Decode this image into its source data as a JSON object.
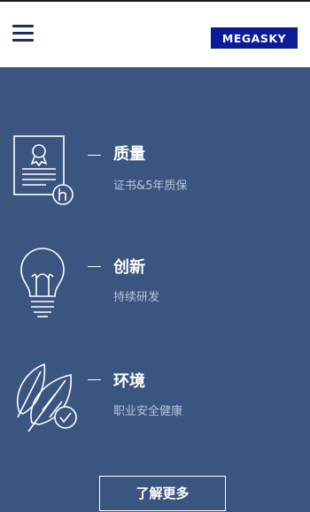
{
  "header": {
    "logo_text": "MEGASKY",
    "menu_icon": "hamburger-menu-icon",
    "logo_color": "#0b1c98"
  },
  "colors": {
    "background": "#3a5580",
    "header_bg": "#ffffff",
    "subtitle": "#b8c4d8"
  },
  "features": [
    {
      "title": "质量",
      "subtitle": "证书&5年质保",
      "icon": "certificate-icon"
    },
    {
      "title": "创新",
      "subtitle": "持续研发",
      "icon": "lightbulb-icon"
    },
    {
      "title": "环境",
      "subtitle": "职业安全健康",
      "icon": "leaf-check-icon"
    }
  ],
  "more_button": {
    "label": "了解更多"
  }
}
